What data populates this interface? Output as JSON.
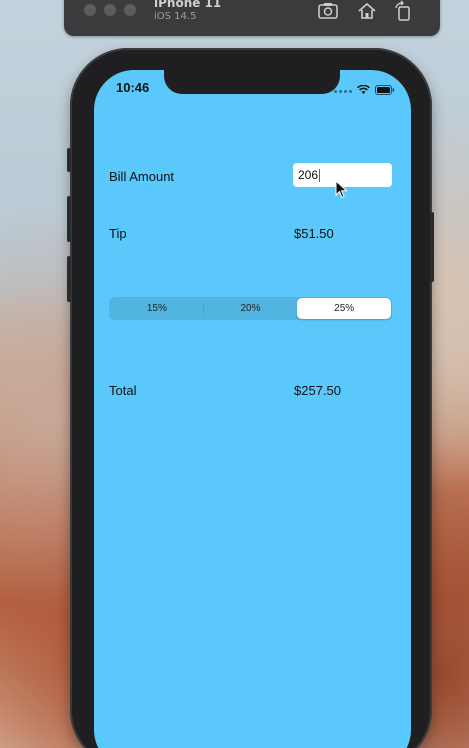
{
  "simulator": {
    "device_name": "iPhone 11",
    "os_version": "iOS 14.5",
    "icons": [
      "screenshot-icon",
      "home-icon",
      "rotate-icon"
    ]
  },
  "status_bar": {
    "time": "10:46",
    "icons": [
      "signal-icon",
      "wifi-icon",
      "battery-icon"
    ]
  },
  "form": {
    "bill_label": "Bill Amount",
    "bill_value": "206",
    "tip_label": "Tip",
    "tip_value": "$51.50",
    "segments": [
      "15%",
      "20%",
      "25%"
    ],
    "selected_segment": "25%",
    "total_label": "Total",
    "total_value": "$257.50"
  },
  "colors": {
    "screen_background": "#5ac8fa",
    "segment_background": "#52b4e0",
    "selected_segment": "#ffffff"
  }
}
